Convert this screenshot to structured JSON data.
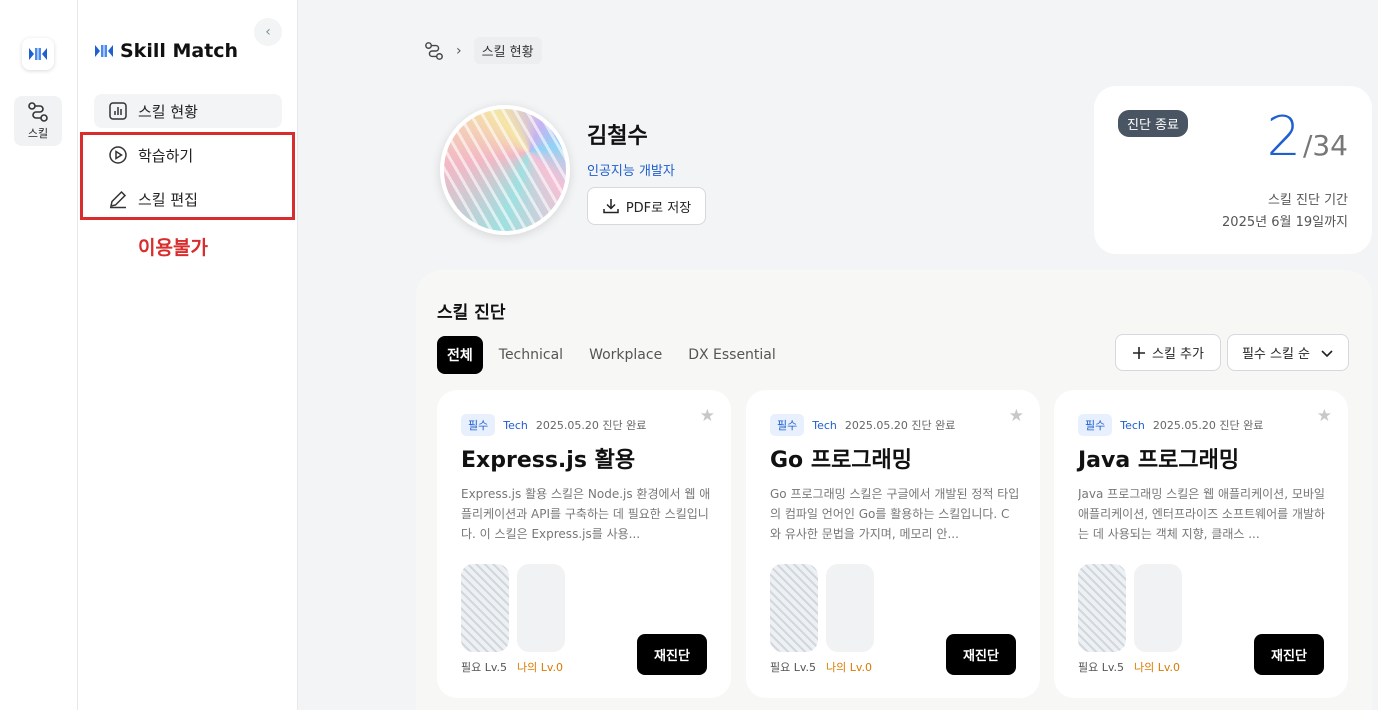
{
  "rail": {
    "skill_label": "스킬"
  },
  "sidebar": {
    "brand": "Skill Match",
    "items": [
      {
        "label": "스킬 현황"
      },
      {
        "label": "학습하기"
      },
      {
        "label": "스킬 편집"
      }
    ],
    "unavailable_note": "이용불가"
  },
  "breadcrumb": {
    "current": "스킬 현황"
  },
  "profile": {
    "name": "김철수",
    "role": "인공지능 개발자",
    "pdf_button": "PDF로 저장"
  },
  "diagnosis": {
    "badge": "진단 종료",
    "done": "2",
    "total": "/34",
    "period_label": "스킬 진단 기간",
    "period_date": "2025년 6월 19일까지"
  },
  "skills_panel": {
    "title": "스킬 진단",
    "tabs": [
      "전체",
      "Technical",
      "Workplace",
      "DX Essential"
    ],
    "active_tab": "전체",
    "add_button": "스킬 추가",
    "sort_label": "필수 스킬 순",
    "cards": [
      {
        "tag": "필수",
        "category": "Tech",
        "date": "2025.05.20 진단 완료",
        "title": "Express.js 활용",
        "desc": "Express.js 활용 스킬은 Node.js 환경에서 웹 애플리케이션과 API를 구축하는 데 필요한 스킬입니다. 이 스킬은 Express.js를 사용...",
        "need_level": "필요 Lv.5",
        "my_level": "나의 Lv.0",
        "button": "재진단"
      },
      {
        "tag": "필수",
        "category": "Tech",
        "date": "2025.05.20 진단 완료",
        "title": "Go 프로그래밍",
        "desc": "Go 프로그래밍 스킬은 구글에서 개발된 정적 타입의 컴파일 언어인 Go를 활용하는 스킬입니다. C와 유사한 문법을 가지며, 메모리 안...",
        "need_level": "필요 Lv.5",
        "my_level": "나의 Lv.0",
        "button": "재진단"
      },
      {
        "tag": "필수",
        "category": "Tech",
        "date": "2025.05.20 진단 완료",
        "title": "Java 프로그래밍",
        "desc": "Java 프로그래밍 스킬은 웹 애플리케이션, 모바일 애플리케이션, 엔터프라이즈 소프트웨어를 개발하는 데 사용되는 객체 지향, 클래스 ...",
        "need_level": "필요 Lv.5",
        "my_level": "나의 Lv.0",
        "button": "재진단"
      }
    ]
  },
  "colors": {
    "accent": "#1f5fcf",
    "highlight_box": "#d92c2c",
    "my_level": "#d97b00"
  }
}
